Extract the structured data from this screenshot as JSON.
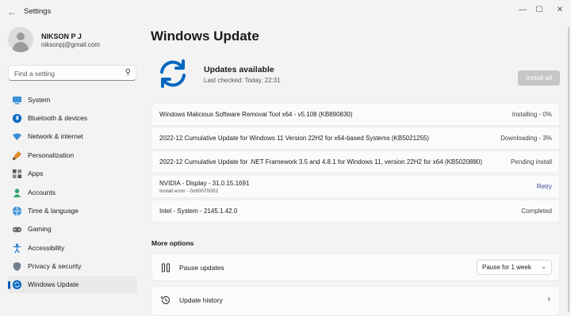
{
  "window": {
    "title": "Settings"
  },
  "user": {
    "name": "NIKSON P J",
    "email": "niksonpj@gmail.com"
  },
  "search": {
    "placeholder": "Find a setting"
  },
  "sidebar": {
    "items": [
      {
        "label": "System",
        "icon": "system-icon"
      },
      {
        "label": "Bluetooth & devices",
        "icon": "bluetooth-icon"
      },
      {
        "label": "Network & internet",
        "icon": "wifi-icon"
      },
      {
        "label": "Personalization",
        "icon": "brush-icon"
      },
      {
        "label": "Apps",
        "icon": "apps-icon"
      },
      {
        "label": "Accounts",
        "icon": "accounts-icon"
      },
      {
        "label": "Time & language",
        "icon": "globe-icon"
      },
      {
        "label": "Gaming",
        "icon": "gamepad-icon"
      },
      {
        "label": "Accessibility",
        "icon": "accessibility-icon"
      },
      {
        "label": "Privacy & security",
        "icon": "shield-icon"
      },
      {
        "label": "Windows Update",
        "icon": "windows-update-icon",
        "active": true
      }
    ]
  },
  "main": {
    "title": "Windows Update",
    "status": {
      "title": "Updates available",
      "subtitle": "Last checked: Today, 22:31"
    },
    "install_label": "Install all",
    "updates": [
      {
        "name": "Windows Malicious Software Removal Tool x64 - v5.108 (KB890830)",
        "status": "Installing - 0%"
      },
      {
        "name": "2022-12 Cumulative Update for Windows 11 Version 22H2 for x64-based Systems (KB5021255)",
        "status": "Downloading - 3%"
      },
      {
        "name": "2022-12 Cumulative Update for .NET Framework 3.5 and 4.8.1 for Windows 11, version 22H2 for x64 (KB5020880)",
        "status": "Pending install"
      },
      {
        "name": "NVIDIA - Display - 31.0.15.1691",
        "error": "Install error - 0x80070002",
        "action": "Retry"
      },
      {
        "name": "Intel - System - 2145.1.42.0",
        "status": "Completed"
      }
    ],
    "more_options": {
      "title": "More options",
      "pause": {
        "label": "Pause updates",
        "select_value": "Pause for 1 week"
      },
      "history": {
        "label": "Update history"
      }
    }
  },
  "colors": {
    "accent": "#005fb8",
    "sync_icon": "#0067c0",
    "disabled_button": "#c6c6c6",
    "retry": "#3a3aa0"
  }
}
